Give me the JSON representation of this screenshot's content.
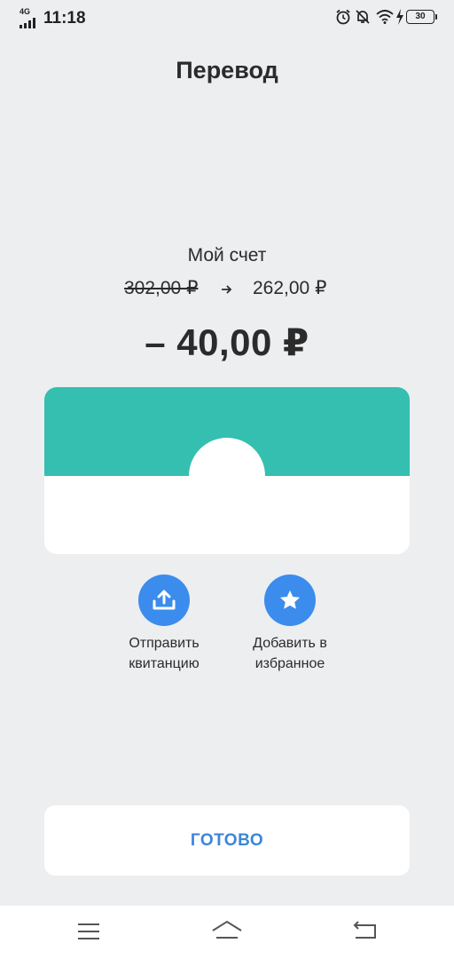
{
  "status_bar": {
    "network": "4G",
    "time": "11:18",
    "battery": "30"
  },
  "header": {
    "title": "Перевод"
  },
  "transfer": {
    "account_name": "Мой счет",
    "balance_before": "302,00 ₽",
    "balance_after": "262,00 ₽",
    "amount": "– 40,00 ₽"
  },
  "card": {
    "accent_color": "#35bfb0"
  },
  "actions": {
    "send_receipt": {
      "line1": "Отправить",
      "line2": "квитанцию",
      "icon": "upload-icon"
    },
    "add_favorite": {
      "line1": "Добавить в",
      "line2": "избранное",
      "icon": "star-icon"
    },
    "button_color": "#3b8ced"
  },
  "footer": {
    "done_label": "ГОТОВО"
  },
  "nav_bar": {
    "icons": [
      "menu-icon",
      "home-icon",
      "back-icon"
    ]
  }
}
